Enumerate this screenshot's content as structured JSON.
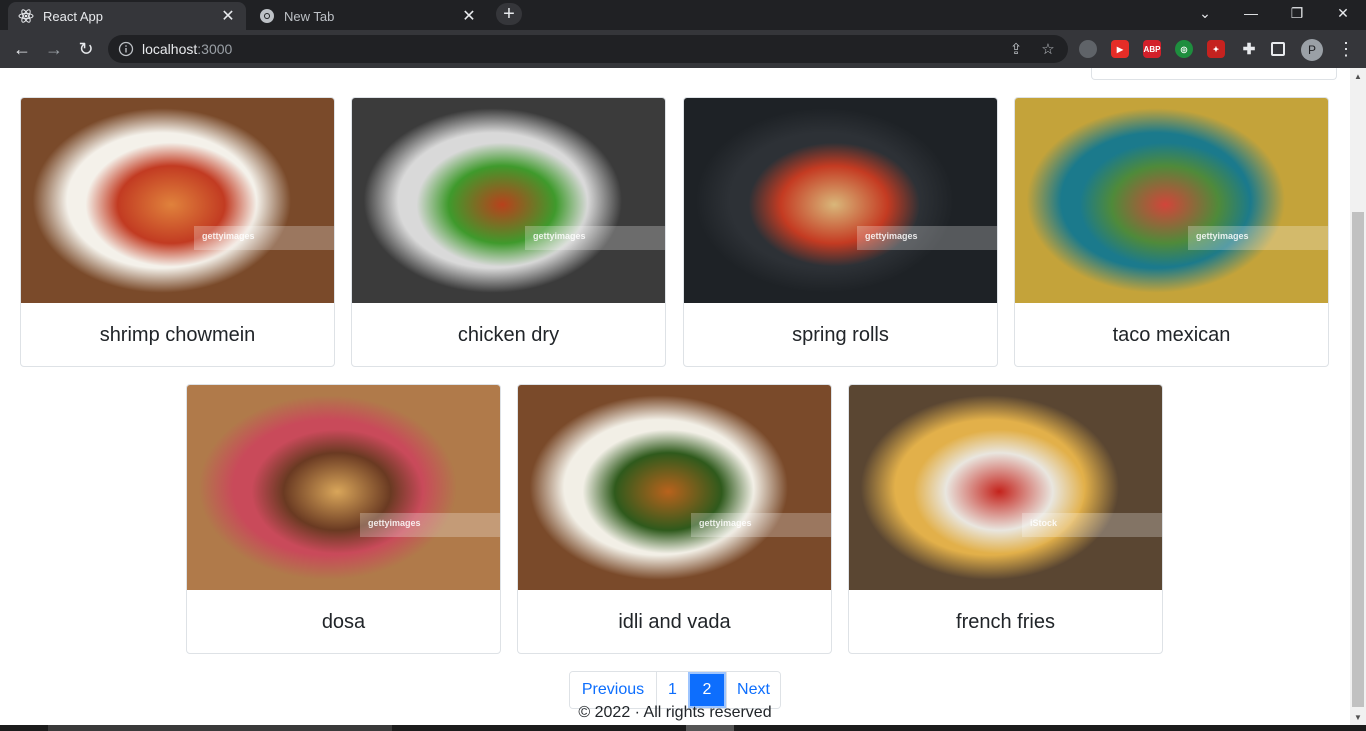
{
  "browser": {
    "tabs": [
      {
        "title": "React App",
        "active": true
      },
      {
        "title": "New Tab",
        "active": false
      }
    ],
    "new_tab_symbol": "+",
    "url": {
      "host": "localhost",
      "port": ":3000"
    },
    "window_controls": {
      "minimize": "—",
      "restore": "❐",
      "close": "✕",
      "dropdown": "⌄"
    },
    "profile_initial": "P",
    "extensions": [
      {
        "icon": "owl-extension-icon",
        "color": "#5f6368",
        "label": ""
      },
      {
        "icon": "video-extension-icon",
        "color": "#e52d27",
        "label": "▶"
      },
      {
        "icon": "adblock-plus-icon",
        "color": "#d3202a",
        "label": "ABP"
      },
      {
        "icon": "target-extension-icon",
        "color": "#1e8e3e",
        "label": "◎"
      },
      {
        "icon": "red-extension-icon",
        "color": "#c5221f",
        "label": "✦"
      }
    ]
  },
  "products": [
    {
      "name": "shrimp chowmein",
      "colors": [
        "#7a4a2a",
        "#f4f1ea",
        "#e0823c",
        "#c23b22"
      ]
    },
    {
      "name": "chicken dry",
      "colors": [
        "#3b3b3b",
        "#d9d9d9",
        "#b8411c",
        "#3f9a2c"
      ]
    },
    {
      "name": "spring rolls",
      "colors": [
        "#1e2226",
        "#2d3136",
        "#d9b77a",
        "#c43b22"
      ]
    },
    {
      "name": "taco mexican",
      "colors": [
        "#c4a33a",
        "#1b7a8c",
        "#d2453a",
        "#4f8a3a"
      ]
    },
    {
      "name": "dosa",
      "colors": [
        "#b07a4a",
        "#c94a5a",
        "#d9a65a",
        "#6a3a22"
      ]
    },
    {
      "name": "idli and vada",
      "colors": [
        "#7a4a2a",
        "#f2efe6",
        "#b8621c",
        "#2f5a1c"
      ]
    },
    {
      "name": "french fries",
      "colors": [
        "#5a4632",
        "#e2b04a",
        "#c4231c",
        "#e9e6df"
      ]
    }
  ],
  "watermarks": [
    "gettyimages",
    "gettyimages",
    "gettyimages",
    "gettyimages",
    "gettyimages",
    "gettyimages",
    "iStock"
  ],
  "pagination": {
    "previous": "Previous",
    "pages": [
      "1",
      "2"
    ],
    "active_page": "2",
    "next": "Next"
  },
  "footer": "© 2022 · All rights reserved"
}
